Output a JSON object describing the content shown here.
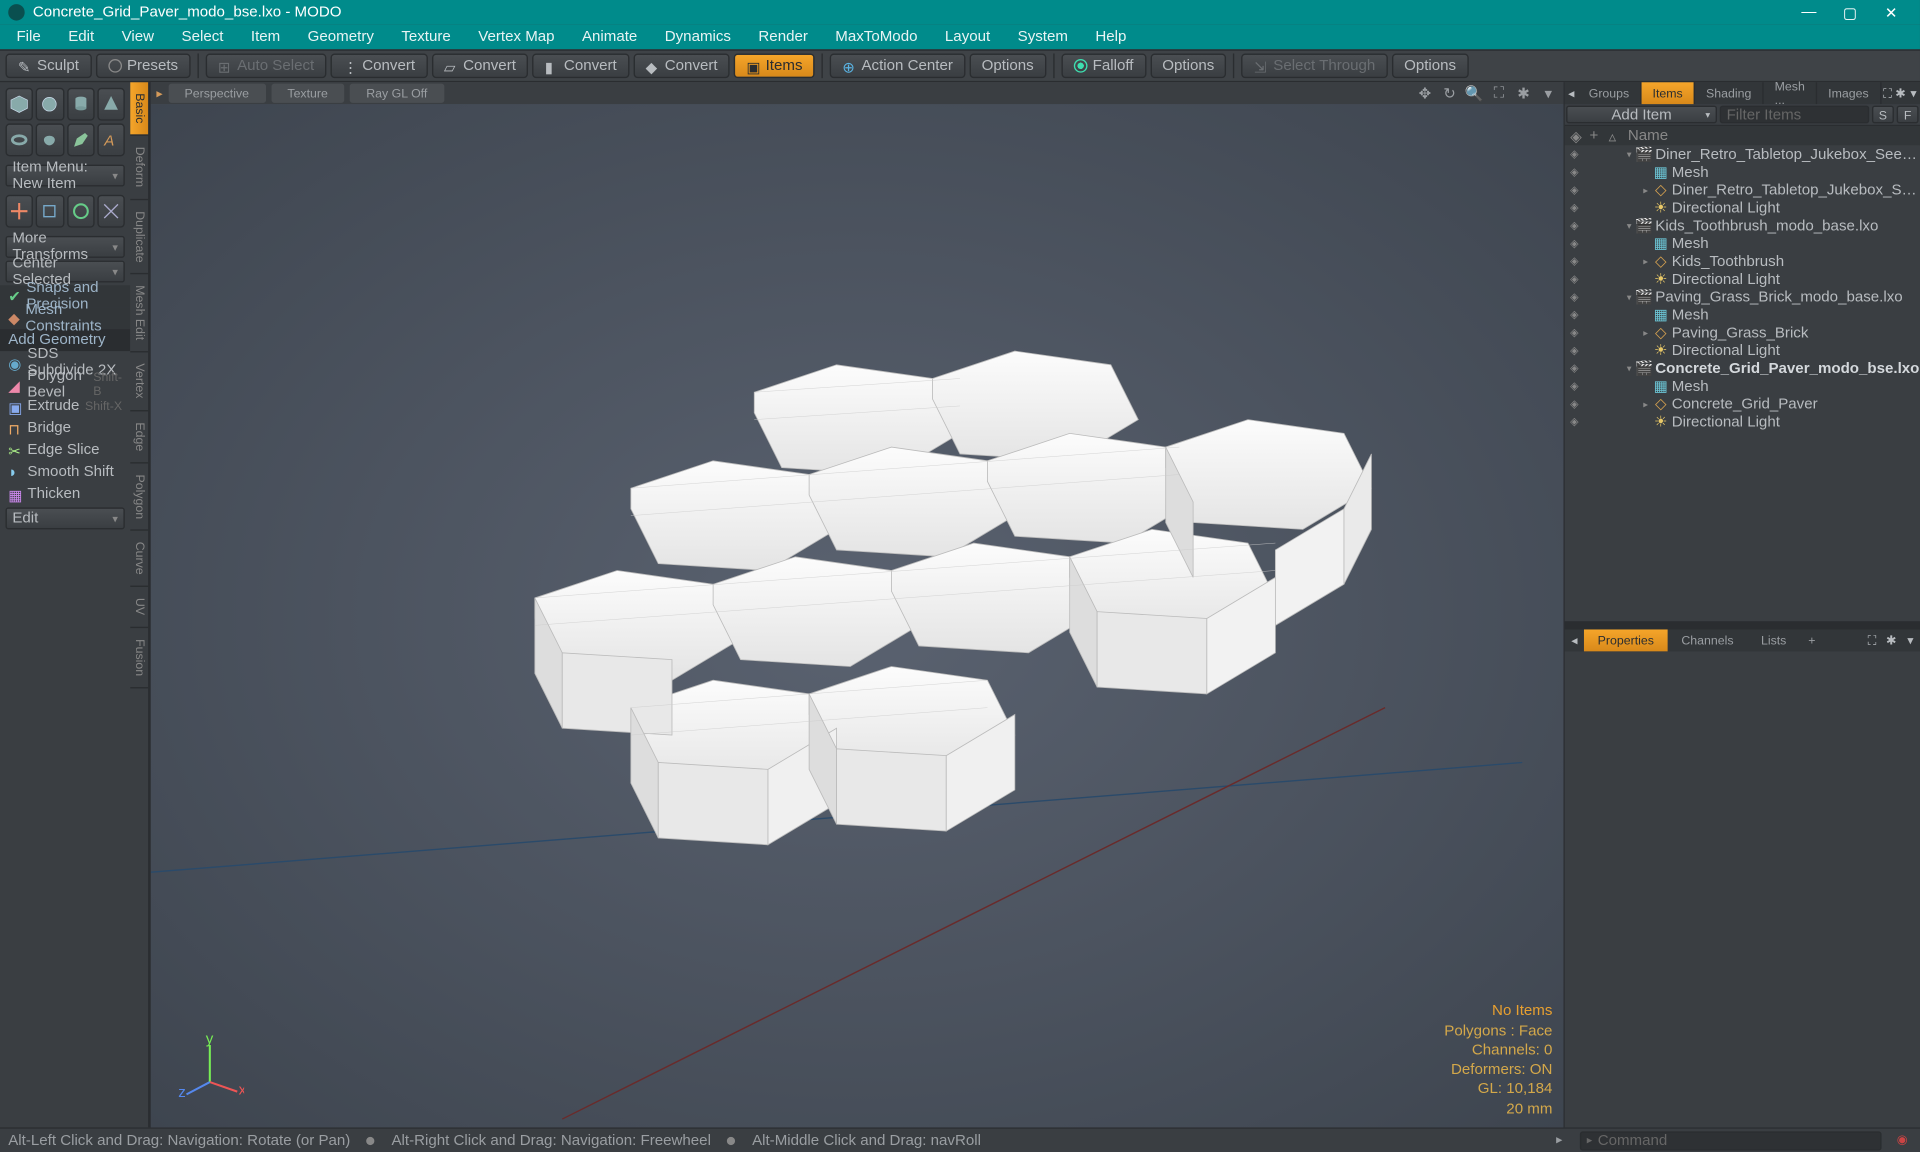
{
  "title": "Concrete_Grid_Paver_modo_bse.lxo - MODO",
  "menu": [
    "File",
    "Edit",
    "View",
    "Select",
    "Item",
    "Geometry",
    "Texture",
    "Vertex Map",
    "Animate",
    "Dynamics",
    "Render",
    "MaxToModo",
    "Layout",
    "System",
    "Help"
  ],
  "toolbar": {
    "sculpt": "Sculpt",
    "presets": "Presets",
    "autoselect": "Auto Select",
    "convert1": "Convert",
    "convert2": "Convert",
    "convert3": "Convert",
    "convert4": "Convert",
    "items": "Items",
    "actioncenter": "Action Center",
    "options1": "Options",
    "falloff": "Falloff",
    "options2": "Options",
    "selectthrough": "Select Through",
    "options3": "Options"
  },
  "left": {
    "tabs": [
      "Basic",
      "Deform",
      "Duplicate",
      "Mesh Edit",
      "Vertex",
      "Edge",
      "Polygon",
      "Curve",
      "UV",
      "Fusion"
    ],
    "itemmenu": "Item Menu: New Item",
    "moretransforms": "More Transforms",
    "centerselected": "Center Selected",
    "snaps": "Snaps and Precision",
    "meshconstraints": "Mesh Constraints",
    "addgeometry": "Add Geometry",
    "tools": [
      {
        "name": "SDS Subdivide 2X",
        "sc": ""
      },
      {
        "name": "Polygon Bevel",
        "sc": "Shift-B"
      },
      {
        "name": "Extrude",
        "sc": "Shift-X"
      },
      {
        "name": "Bridge",
        "sc": ""
      },
      {
        "name": "Edge Slice",
        "sc": ""
      },
      {
        "name": "Smooth Shift",
        "sc": ""
      },
      {
        "name": "Thicken",
        "sc": ""
      }
    ],
    "edit": "Edit"
  },
  "viewport": {
    "tabs": [
      "Perspective",
      "Texture",
      "Ray GL Off"
    ],
    "stats": {
      "noitems": "No Items",
      "polygons": "Polygons : Face",
      "channels": "Channels: 0",
      "deformers": "Deformers: ON",
      "gl": "GL: 10,184",
      "units": "20 mm"
    }
  },
  "right": {
    "tabs": [
      "Groups",
      "Items",
      "Shading",
      "Mesh ...",
      "Images"
    ],
    "additem": "Add Item",
    "filteritems": "Filter Items",
    "hdr_name": "Name",
    "tree": [
      {
        "d": 0,
        "exp": "▾",
        "ico": "scene",
        "name": "Diner_Retro_Tabletop_Jukebox_Seeburg_ ..."
      },
      {
        "d": 1,
        "exp": "",
        "ico": "mesh",
        "name": "Mesh"
      },
      {
        "d": 1,
        "exp": "▸",
        "ico": "loc",
        "name": "Diner_Retro_Tabletop_Jukebox_Seebur ..."
      },
      {
        "d": 1,
        "exp": "",
        "ico": "light",
        "name": "Directional Light"
      },
      {
        "d": 0,
        "exp": "▾",
        "ico": "scene",
        "name": "Kids_Toothbrush_modo_base.lxo"
      },
      {
        "d": 1,
        "exp": "",
        "ico": "mesh",
        "name": "Mesh"
      },
      {
        "d": 1,
        "exp": "▸",
        "ico": "loc",
        "name": "Kids_Toothbrush"
      },
      {
        "d": 1,
        "exp": "",
        "ico": "light",
        "name": "Directional Light"
      },
      {
        "d": 0,
        "exp": "▾",
        "ico": "scene",
        "name": "Paving_Grass_Brick_modo_base.lxo"
      },
      {
        "d": 1,
        "exp": "",
        "ico": "mesh",
        "name": "Mesh"
      },
      {
        "d": 1,
        "exp": "▸",
        "ico": "loc",
        "name": "Paving_Grass_Brick"
      },
      {
        "d": 1,
        "exp": "",
        "ico": "light",
        "name": "Directional Light"
      },
      {
        "d": 0,
        "exp": "▾",
        "ico": "scene",
        "name": "Concrete_Grid_Paver_modo_bse.lxo",
        "bold": true,
        "sel": false
      },
      {
        "d": 1,
        "exp": "",
        "ico": "mesh",
        "name": "Mesh",
        "dim": true
      },
      {
        "d": 1,
        "exp": "▸",
        "ico": "loc",
        "name": "Concrete_Grid_Paver"
      },
      {
        "d": 1,
        "exp": "",
        "ico": "light",
        "name": "Directional Light"
      }
    ],
    "proptabs": [
      "Properties",
      "Channels",
      "Lists"
    ]
  },
  "status": {
    "s1": "Alt-Left Click and Drag: Navigation: Rotate (or Pan)",
    "s2": "Alt-Right Click and Drag: Navigation: Freewheel",
    "s3": "Alt-Middle Click and Drag: navRoll",
    "cmd": "Command"
  }
}
